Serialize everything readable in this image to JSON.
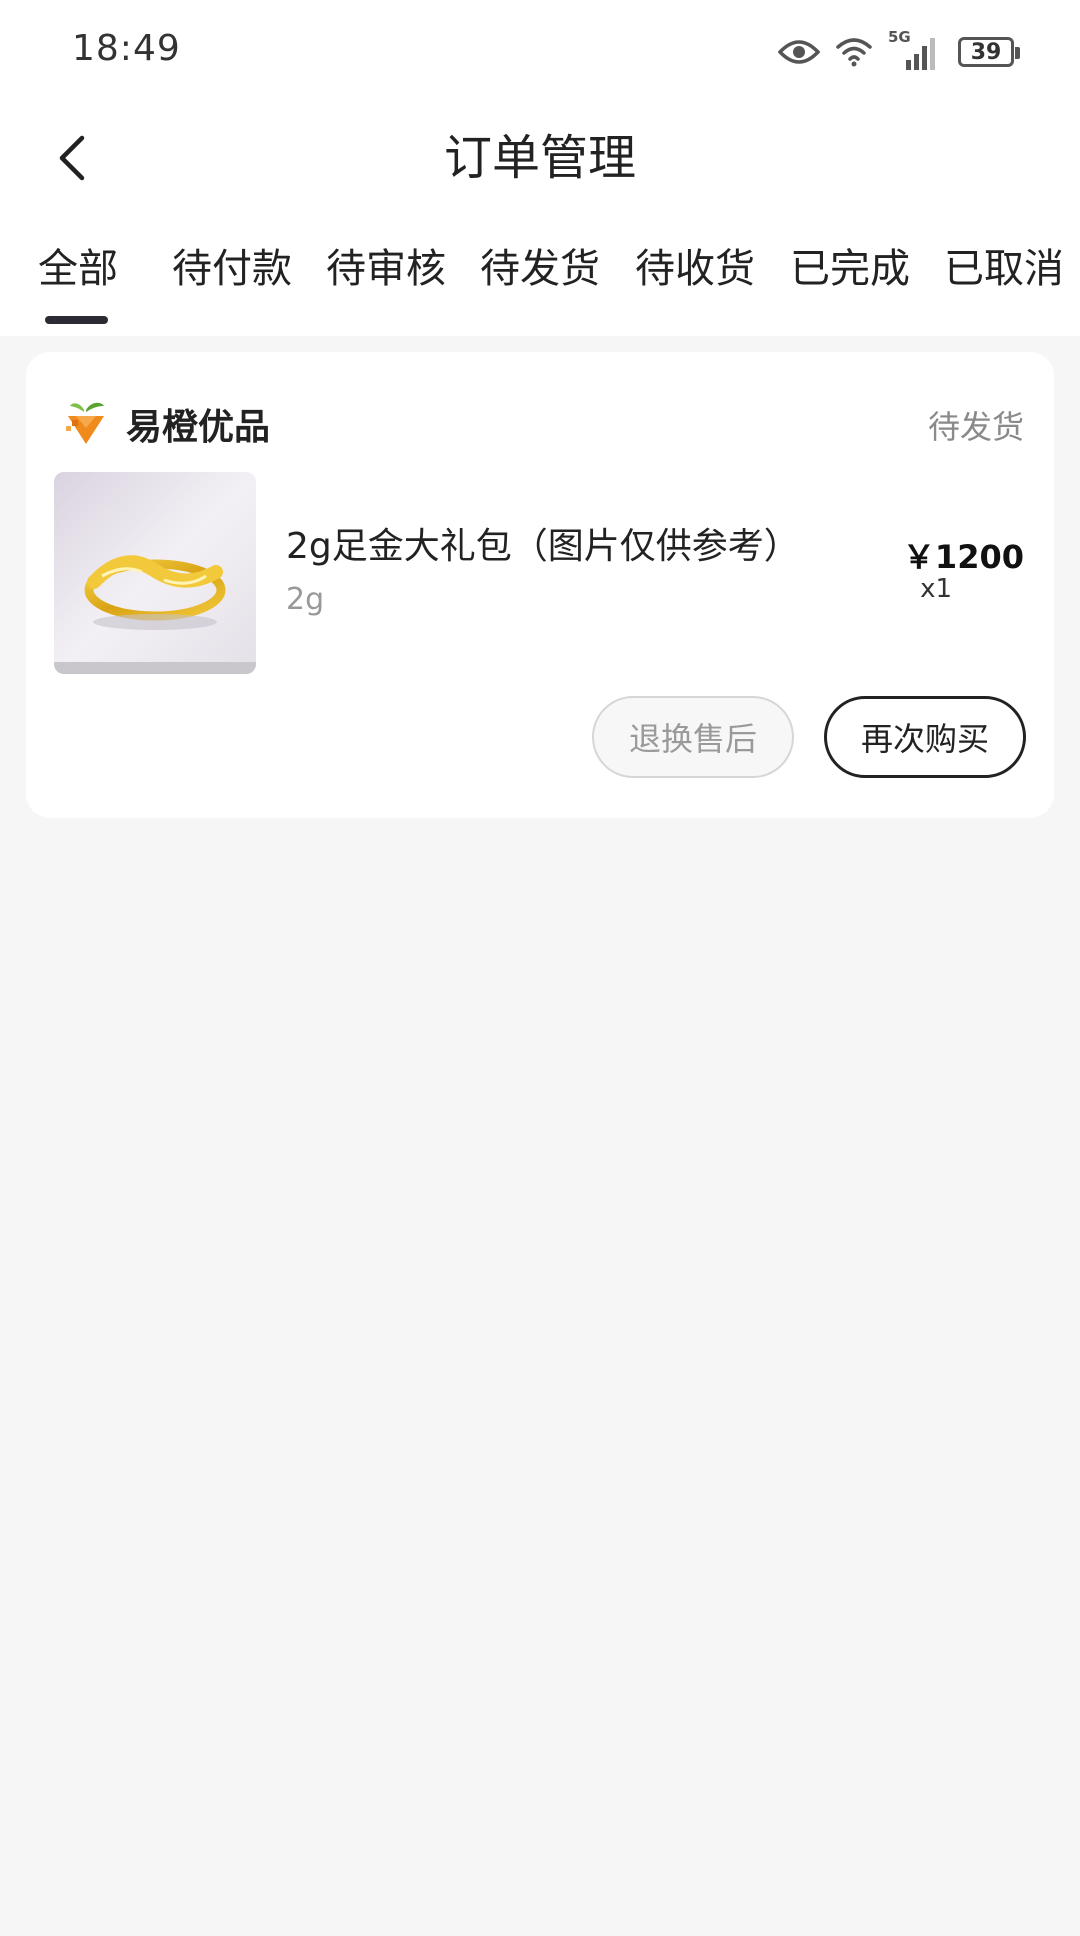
{
  "status_bar": {
    "time": "18:49",
    "network_label": "5G",
    "battery": "39",
    "icons": [
      "eye-icon",
      "wifi-icon",
      "signal-icon",
      "battery-icon"
    ]
  },
  "nav": {
    "title": "订单管理",
    "back_icon": "chevron-left-icon"
  },
  "tabs": [
    {
      "label": "全部",
      "active": true
    },
    {
      "label": "待付款",
      "active": false
    },
    {
      "label": "待审核",
      "active": false
    },
    {
      "label": "待发货",
      "active": false
    },
    {
      "label": "待收货",
      "active": false
    },
    {
      "label": "已完成",
      "active": false
    },
    {
      "label": "已取消",
      "active": false
    }
  ],
  "order": {
    "shop_name": "易橙优品",
    "status": "待发货",
    "product": {
      "name": "2g足金大礼包（图片仅供参考）",
      "spec": "2g",
      "price": "￥1200",
      "quantity": "x1"
    },
    "actions": {
      "after_sales": "退换售后",
      "buy_again": "再次购买"
    }
  },
  "colors": {
    "page_background": "#f6f6f6",
    "tab_indicator": "#2b2b33",
    "muted_text": "#8a8a8a",
    "gold": "#e0b21c"
  }
}
